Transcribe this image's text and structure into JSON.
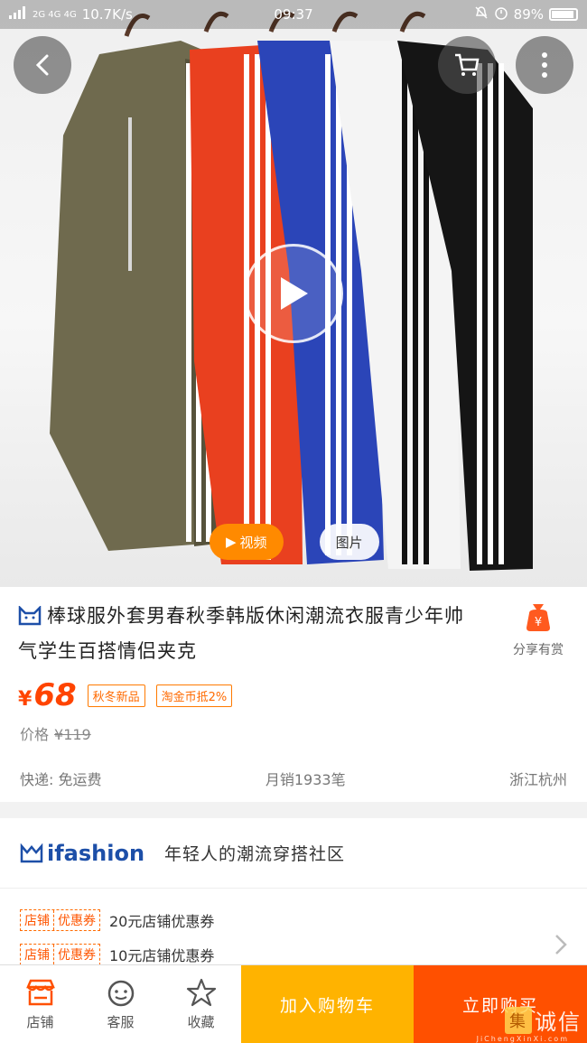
{
  "status_bar": {
    "network": "2G 4G 4G",
    "speed": "10.7K/s",
    "time": "09:37",
    "battery": "89%"
  },
  "media": {
    "tab_video": "视频",
    "tab_image": "图片"
  },
  "product": {
    "title": "棒球服外套男春秋季韩版休闲潮流衣服青少年帅气学生百搭情侣夹克",
    "share_label": "分享有赏",
    "currency": "¥",
    "price": "68",
    "tag_new": "秋冬新品",
    "tag_coin": "淘金币抵2%",
    "old_price_label": "价格",
    "old_price": "¥119",
    "shipping": "快递: 免运费",
    "monthly_sales": "月销1933笔",
    "location": "浙江杭州"
  },
  "ifashion": {
    "logo_text": "ifashion",
    "slogan": "年轻人的潮流穿搭社区"
  },
  "coupons": [
    {
      "badge_a": "店铺",
      "badge_b": "优惠券",
      "text": "20元店铺优惠券"
    },
    {
      "badge_a": "店铺",
      "badge_b": "优惠券",
      "text": "10元店铺优惠券"
    }
  ],
  "bottom_bar": {
    "shop": "店铺",
    "service": "客服",
    "favorite": "收藏",
    "add_cart": "加入购物车",
    "buy_now": "立即购买"
  },
  "watermark": {
    "glyph": "集",
    "text": "诚信",
    "sub": "JiChengXinXi.com"
  },
  "colors": {
    "accent_orange": "#ff5000",
    "cart_yellow": "#ffb300",
    "price_red": "#ff4400"
  }
}
